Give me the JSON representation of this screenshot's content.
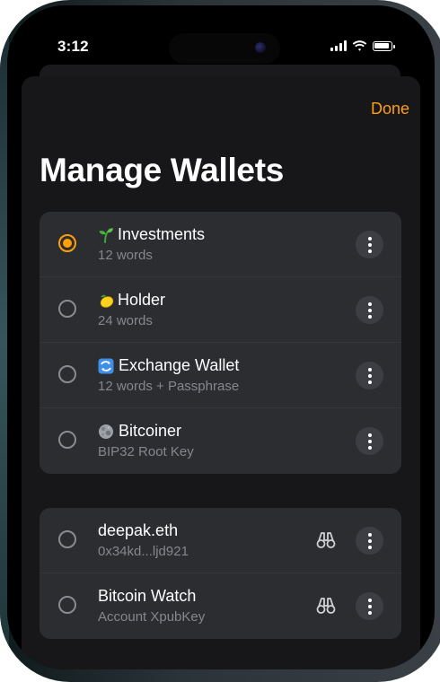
{
  "status_bar": {
    "time": "3:12"
  },
  "header": {
    "done_label": "Done",
    "title": "Manage Wallets"
  },
  "wallets": [
    {
      "icon": "sprout-emoji-icon",
      "name": "Investments",
      "subtitle": "12 words",
      "selected": true
    },
    {
      "icon": "lemon-emoji-icon",
      "name": "Holder",
      "subtitle": "24 words",
      "selected": false
    },
    {
      "icon": "exchange-emoji-icon",
      "name": "Exchange Wallet",
      "subtitle": "12 words + Passphrase",
      "selected": false
    },
    {
      "icon": "moon-emoji-icon",
      "name": "Bitcoiner",
      "subtitle": "BIP32 Root Key",
      "selected": false
    }
  ],
  "watch_wallets": [
    {
      "name": "deepak.eth",
      "subtitle": "0x34kd...ljd921",
      "selected": false
    },
    {
      "name": "Bitcoin Watch",
      "subtitle": "Account XpubKey",
      "selected": false
    }
  ],
  "colors": {
    "accent": "#ff9f0a",
    "sheet_background": "#17171a",
    "group_background": "#2b2d31",
    "secondary_text": "#86878c"
  }
}
